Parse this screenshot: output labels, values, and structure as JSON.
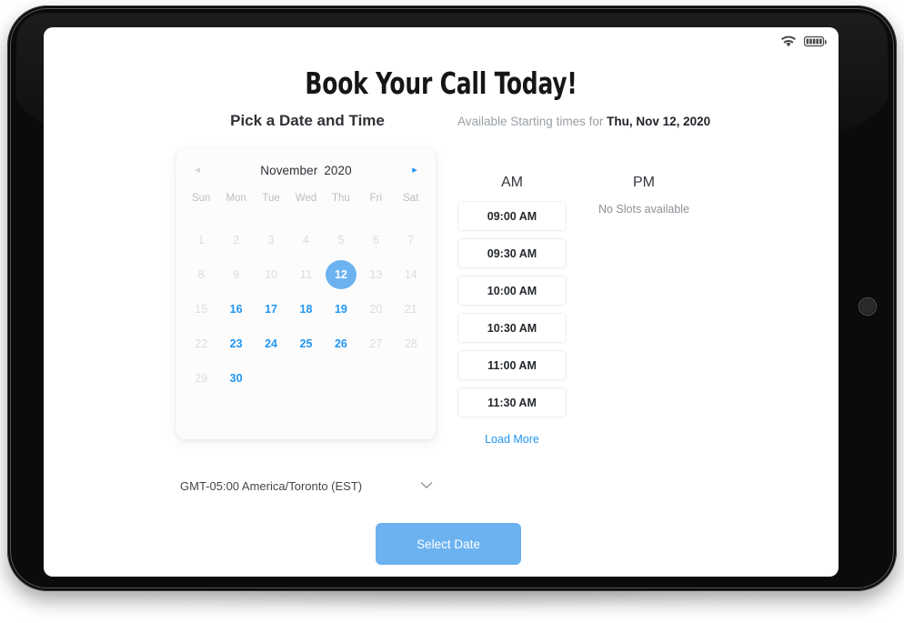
{
  "status_bar": {
    "wifi_icon": "wifi-icon",
    "battery_icon": "battery-icon",
    "battery_bars": 5
  },
  "page": {
    "title": "Book Your Call Today!"
  },
  "left_panel": {
    "heading": "Pick a Date and Time",
    "calendar": {
      "prev_label": "◂",
      "next_label": "▸",
      "month": "November",
      "year": "2020",
      "weekdays": [
        "Sun",
        "Mon",
        "Tue",
        "Wed",
        "Thu",
        "Fri",
        "Sat"
      ],
      "leading_blanks": 0,
      "days": [
        {
          "n": 1,
          "state": "disabled"
        },
        {
          "n": 2,
          "state": "disabled"
        },
        {
          "n": 3,
          "state": "disabled"
        },
        {
          "n": 4,
          "state": "disabled"
        },
        {
          "n": 5,
          "state": "disabled"
        },
        {
          "n": 6,
          "state": "disabled"
        },
        {
          "n": 7,
          "state": "disabled"
        },
        {
          "n": 8,
          "state": "disabled"
        },
        {
          "n": 9,
          "state": "disabled"
        },
        {
          "n": 10,
          "state": "disabled"
        },
        {
          "n": 11,
          "state": "disabled"
        },
        {
          "n": 12,
          "state": "selected"
        },
        {
          "n": 13,
          "state": "disabled"
        },
        {
          "n": 14,
          "state": "disabled"
        },
        {
          "n": 15,
          "state": "disabled"
        },
        {
          "n": 16,
          "state": "available"
        },
        {
          "n": 17,
          "state": "available"
        },
        {
          "n": 18,
          "state": "available"
        },
        {
          "n": 19,
          "state": "available"
        },
        {
          "n": 20,
          "state": "disabled"
        },
        {
          "n": 21,
          "state": "disabled"
        },
        {
          "n": 22,
          "state": "disabled"
        },
        {
          "n": 23,
          "state": "available"
        },
        {
          "n": 24,
          "state": "available"
        },
        {
          "n": 25,
          "state": "available"
        },
        {
          "n": 26,
          "state": "available"
        },
        {
          "n": 27,
          "state": "disabled"
        },
        {
          "n": 28,
          "state": "disabled"
        },
        {
          "n": 29,
          "state": "disabled"
        },
        {
          "n": 30,
          "state": "available"
        }
      ]
    },
    "timezone": {
      "value": "GMT-05:00 America/Toronto (EST)",
      "caret_icon": "chevron-down-icon"
    }
  },
  "right_panel": {
    "heading_prefix": "Available Starting times for ",
    "heading_date": "Thu, Nov 12, 2020",
    "am": {
      "label": "AM",
      "slots": [
        "09:00 AM",
        "09:30 AM",
        "10:00 AM",
        "10:30 AM",
        "11:00 AM",
        "11:30 AM"
      ],
      "load_more_label": "Load More"
    },
    "pm": {
      "label": "PM",
      "empty_message": "No Slots available"
    }
  },
  "footer": {
    "select_date_label": "Select Date"
  },
  "colors": {
    "accent_blue": "#2196f3",
    "button_blue": "#6cb2f0",
    "text_dark": "#24282d",
    "text_muted": "#9aa0a6",
    "disabled_day": "#dcdce1"
  }
}
